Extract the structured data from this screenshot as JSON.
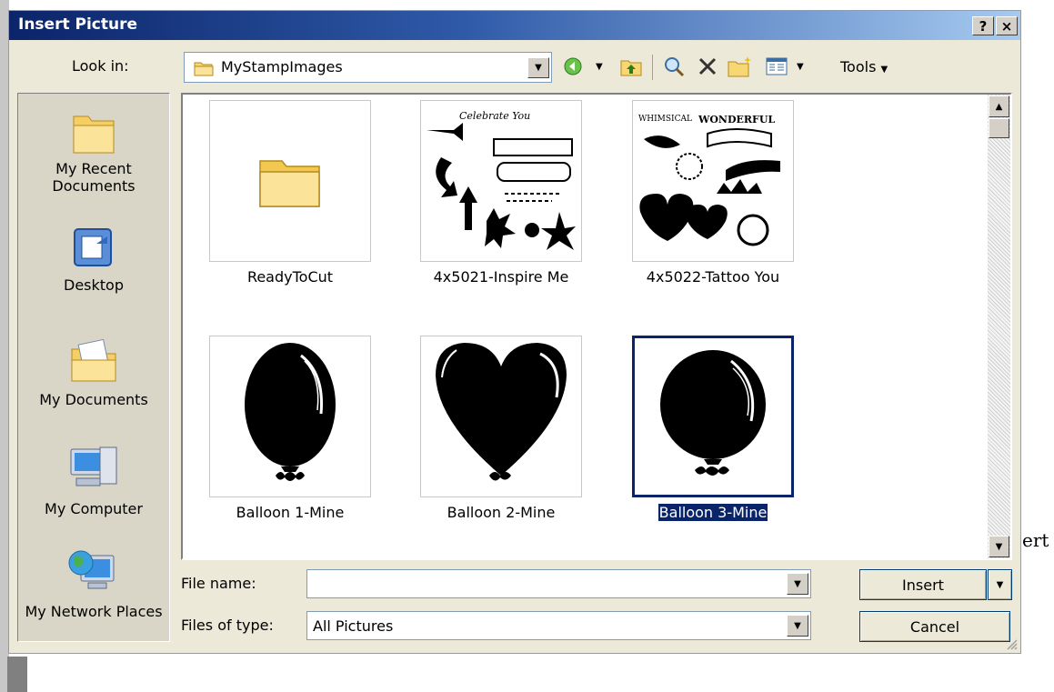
{
  "dialog": {
    "title": "Insert Picture",
    "help_button": "?",
    "close_button": "×"
  },
  "look_in": {
    "label": "Look in:",
    "value": "MyStampImages"
  },
  "toolbar": {
    "tools_label": "Tools",
    "icons": [
      "back-icon",
      "up-folder-icon",
      "search-web-icon",
      "delete-icon",
      "new-folder-icon",
      "views-icon"
    ]
  },
  "places": [
    {
      "label": "My Recent Documents",
      "icon": "recent-documents-icon"
    },
    {
      "label": "Desktop",
      "icon": "desktop-icon"
    },
    {
      "label": "My Documents",
      "icon": "my-documents-icon"
    },
    {
      "label": "My Computer",
      "icon": "my-computer-icon"
    },
    {
      "label": "My Network Places",
      "icon": "network-places-icon"
    }
  ],
  "files": [
    {
      "name": "ReadyToCut",
      "kind": "folder"
    },
    {
      "name": "4x5021-Inspire Me",
      "kind": "stamp-sheet"
    },
    {
      "name": "4x5022-Tattoo You",
      "kind": "stamp-sheet"
    },
    {
      "name": "Balloon 1-Mine",
      "kind": "balloon-oval"
    },
    {
      "name": "Balloon 2-Mine",
      "kind": "balloon-heart"
    },
    {
      "name": "Balloon 3-Mine",
      "kind": "balloon-round",
      "selected": true
    }
  ],
  "form": {
    "file_name_label": "File name:",
    "file_name_value": "",
    "file_type_label": "Files of type:",
    "file_type_value": "All Pictures"
  },
  "buttons": {
    "insert": "Insert",
    "cancel": "Cancel"
  },
  "background": {
    "partial_text": "ert"
  }
}
